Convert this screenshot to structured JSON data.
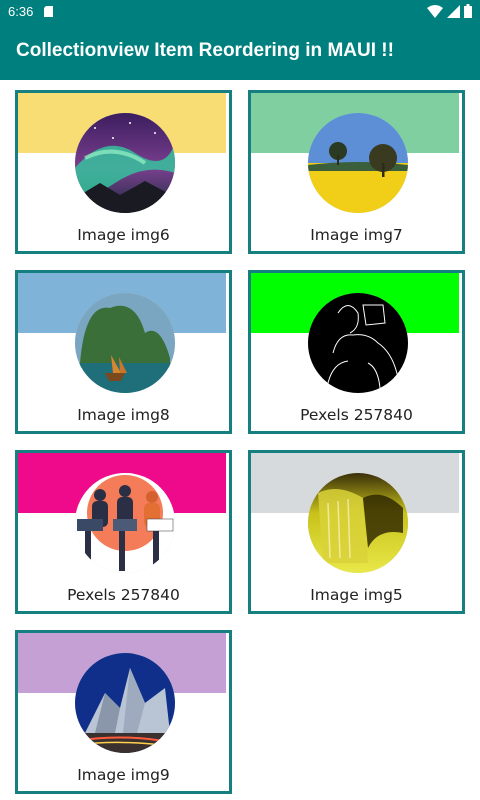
{
  "status_bar": {
    "time": "6:36",
    "icons": [
      "sd-card-icon",
      "wifi-icon",
      "cellular-signal-icon",
      "battery-icon"
    ]
  },
  "app_bar": {
    "title": "Collectionview Item Reordering in MAUI !!",
    "background": "#007f7f"
  },
  "collection": {
    "border_color": "#168080",
    "items": [
      {
        "label": "Image img6",
        "band_color": "#f8dc74",
        "image": "aurora-photo"
      },
      {
        "label": "Image img7",
        "band_color": "#7fcfa0",
        "image": "rapeseed-field-photo"
      },
      {
        "label": "Image img8",
        "band_color": "#7fb3d8",
        "image": "halong-bay-photo"
      },
      {
        "label": "Pexels 257840",
        "band_color": "#00ff00",
        "image": "line-art-couple-photo"
      },
      {
        "label": "Pexels 257840",
        "band_color": "#ef0a8c",
        "image": "people-with-laptops-illustration"
      },
      {
        "label": "Image img5",
        "band_color": "#d7dadc",
        "image": "waterfall-photo"
      },
      {
        "label": "Image img9",
        "band_color": "#c5a0d4",
        "image": "modern-building-photo"
      }
    ]
  }
}
